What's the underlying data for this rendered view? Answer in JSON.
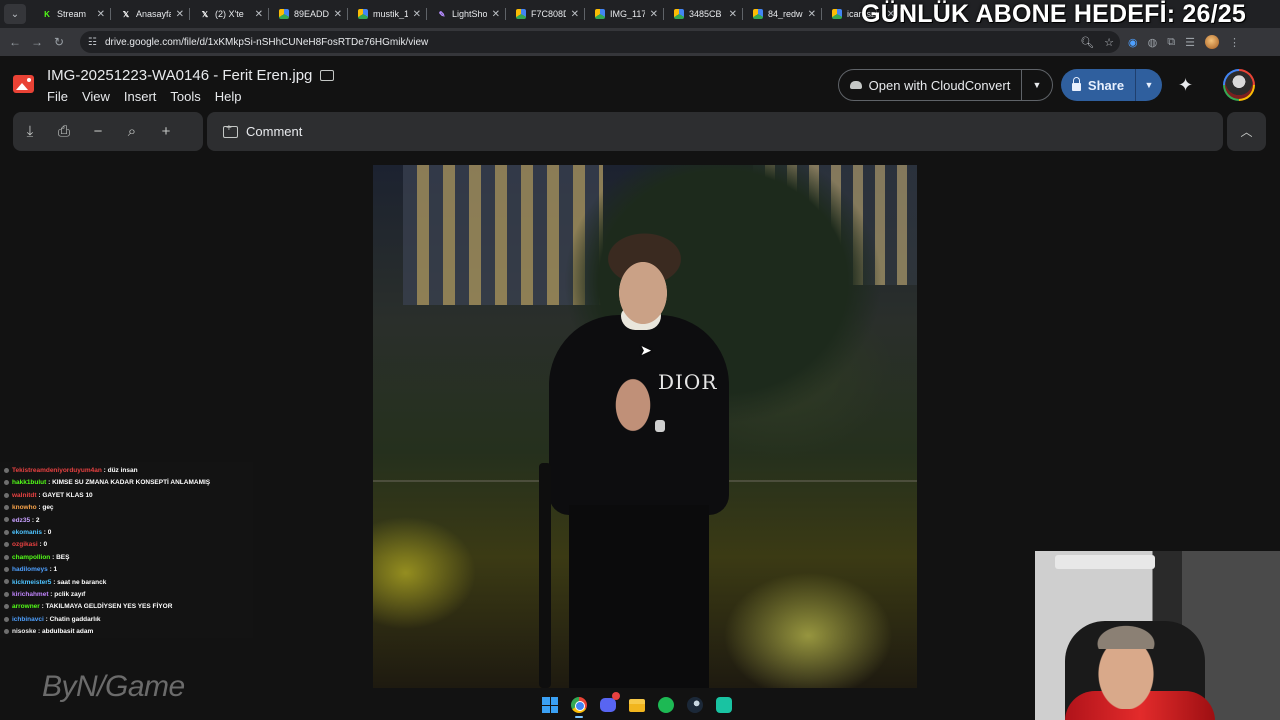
{
  "browser": {
    "tabs": [
      {
        "label": "Stream",
        "icon": "kick-icon",
        "color": "#53fc18"
      },
      {
        "label": "Anasayfa",
        "icon": "x-icon",
        "color": "#ffffff"
      },
      {
        "label": "(2) X'te",
        "icon": "x-icon",
        "color": "#ffffff"
      },
      {
        "label": "89EADD",
        "icon": "drive-icon",
        "color": "#fbbc05"
      },
      {
        "label": "mustik_1",
        "icon": "drive-icon",
        "color": "#fbbc05"
      },
      {
        "label": "LightSho",
        "icon": "pen-icon",
        "color": "#b68cff"
      },
      {
        "label": "F7C808D",
        "icon": "drive-icon",
        "color": "#fbbc05"
      },
      {
        "label": "IMG_117",
        "icon": "drive-icon",
        "color": "#fbbc05"
      },
      {
        "label": "3485CB",
        "icon": "drive-icon",
        "color": "#fbbc05"
      },
      {
        "label": "84_redw",
        "icon": "drive-icon",
        "color": "#fbbc05"
      },
      {
        "label": "icaruszi",
        "icon": "drive-icon",
        "color": "#fbbc05"
      }
    ],
    "url": "drive.google.com/file/d/1xKMkpSi-nSHhCUNeH8FosRTDe76HGmik/view"
  },
  "overlay": {
    "goal_text": "GÜNLÜK ABONE HEDEFİ: 26/25"
  },
  "viewer": {
    "title": "IMG-20251223-WA0146 - Ferit Eren.jpg",
    "menu": [
      "File",
      "View",
      "Insert",
      "Tools",
      "Help"
    ],
    "open_with_label": "Open with CloudConvert",
    "share_label": "Share",
    "comment_label": "Comment"
  },
  "photo": {
    "shirt_text": "DIOR"
  },
  "chat": {
    "messages": [
      {
        "user": "Tekistreamdeniyorduyum4an",
        "user_color": "#e84141",
        "text": "düz insan"
      },
      {
        "user": "hakk1bulut",
        "user_color": "#53fc18",
        "text": "KIMSE SU ZMANA KADAR KONSEPTİ ANLAMAMIŞ"
      },
      {
        "user": "walnitdt",
        "user_color": "#e84141",
        "text": "GAYET KLAS 10"
      },
      {
        "user": "knowho",
        "user_color": "#f7a34a",
        "text": "geç"
      },
      {
        "user": "edz35",
        "user_color": "#c7a0ff",
        "text": "2"
      },
      {
        "user": "ekomanis",
        "user_color": "#4ec4ff",
        "text": "0"
      },
      {
        "user": "ozgikasi",
        "user_color": "#e84141",
        "text": "0"
      },
      {
        "user": "champollion",
        "user_color": "#53fc18",
        "text": "BEŞ"
      },
      {
        "user": "hadilomeys",
        "user_color": "#4ea0ff",
        "text": "1"
      },
      {
        "user": "kickmeister5",
        "user_color": "#4ec4ff",
        "text": "saat ne baranck"
      },
      {
        "user": "kirichahmet",
        "user_color": "#c084fc",
        "text": "pclik zayıf"
      },
      {
        "user": "arrowner",
        "user_color": "#53fc18",
        "text": "TAKILMAYA GELDİYSEN YES YES FİYOR"
      },
      {
        "user": "ichbinavci",
        "user_color": "#4ea0ff",
        "text": "Chatin gaddarlık"
      },
      {
        "user": "nisoske",
        "user_color": "#f0f0f0",
        "text": "abdulbasit adam"
      }
    ],
    "watermark": "ByN/Game"
  },
  "taskbar": {
    "apps": [
      "windows-start-icon",
      "chrome-icon",
      "discord-icon",
      "file-explorer-icon",
      "spotify-icon",
      "steam-icon",
      "app-icon"
    ]
  }
}
